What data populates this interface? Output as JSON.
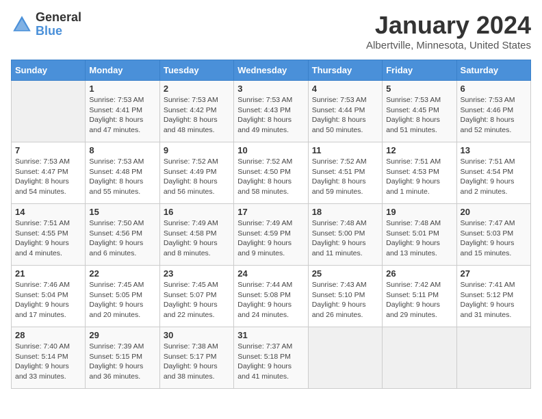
{
  "header": {
    "logo_general": "General",
    "logo_blue": "Blue",
    "month_title": "January 2024",
    "location": "Albertville, Minnesota, United States"
  },
  "days_of_week": [
    "Sunday",
    "Monday",
    "Tuesday",
    "Wednesday",
    "Thursday",
    "Friday",
    "Saturday"
  ],
  "weeks": [
    [
      {
        "day": "",
        "info": ""
      },
      {
        "day": "1",
        "info": "Sunrise: 7:53 AM\nSunset: 4:41 PM\nDaylight: 8 hours\nand 47 minutes."
      },
      {
        "day": "2",
        "info": "Sunrise: 7:53 AM\nSunset: 4:42 PM\nDaylight: 8 hours\nand 48 minutes."
      },
      {
        "day": "3",
        "info": "Sunrise: 7:53 AM\nSunset: 4:43 PM\nDaylight: 8 hours\nand 49 minutes."
      },
      {
        "day": "4",
        "info": "Sunrise: 7:53 AM\nSunset: 4:44 PM\nDaylight: 8 hours\nand 50 minutes."
      },
      {
        "day": "5",
        "info": "Sunrise: 7:53 AM\nSunset: 4:45 PM\nDaylight: 8 hours\nand 51 minutes."
      },
      {
        "day": "6",
        "info": "Sunrise: 7:53 AM\nSunset: 4:46 PM\nDaylight: 8 hours\nand 52 minutes."
      }
    ],
    [
      {
        "day": "7",
        "info": "Sunrise: 7:53 AM\nSunset: 4:47 PM\nDaylight: 8 hours\nand 54 minutes."
      },
      {
        "day": "8",
        "info": "Sunrise: 7:53 AM\nSunset: 4:48 PM\nDaylight: 8 hours\nand 55 minutes."
      },
      {
        "day": "9",
        "info": "Sunrise: 7:52 AM\nSunset: 4:49 PM\nDaylight: 8 hours\nand 56 minutes."
      },
      {
        "day": "10",
        "info": "Sunrise: 7:52 AM\nSunset: 4:50 PM\nDaylight: 8 hours\nand 58 minutes."
      },
      {
        "day": "11",
        "info": "Sunrise: 7:52 AM\nSunset: 4:51 PM\nDaylight: 8 hours\nand 59 minutes."
      },
      {
        "day": "12",
        "info": "Sunrise: 7:51 AM\nSunset: 4:53 PM\nDaylight: 9 hours\nand 1 minute."
      },
      {
        "day": "13",
        "info": "Sunrise: 7:51 AM\nSunset: 4:54 PM\nDaylight: 9 hours\nand 2 minutes."
      }
    ],
    [
      {
        "day": "14",
        "info": "Sunrise: 7:51 AM\nSunset: 4:55 PM\nDaylight: 9 hours\nand 4 minutes."
      },
      {
        "day": "15",
        "info": "Sunrise: 7:50 AM\nSunset: 4:56 PM\nDaylight: 9 hours\nand 6 minutes."
      },
      {
        "day": "16",
        "info": "Sunrise: 7:49 AM\nSunset: 4:58 PM\nDaylight: 9 hours\nand 8 minutes."
      },
      {
        "day": "17",
        "info": "Sunrise: 7:49 AM\nSunset: 4:59 PM\nDaylight: 9 hours\nand 9 minutes."
      },
      {
        "day": "18",
        "info": "Sunrise: 7:48 AM\nSunset: 5:00 PM\nDaylight: 9 hours\nand 11 minutes."
      },
      {
        "day": "19",
        "info": "Sunrise: 7:48 AM\nSunset: 5:01 PM\nDaylight: 9 hours\nand 13 minutes."
      },
      {
        "day": "20",
        "info": "Sunrise: 7:47 AM\nSunset: 5:03 PM\nDaylight: 9 hours\nand 15 minutes."
      }
    ],
    [
      {
        "day": "21",
        "info": "Sunrise: 7:46 AM\nSunset: 5:04 PM\nDaylight: 9 hours\nand 17 minutes."
      },
      {
        "day": "22",
        "info": "Sunrise: 7:45 AM\nSunset: 5:05 PM\nDaylight: 9 hours\nand 20 minutes."
      },
      {
        "day": "23",
        "info": "Sunrise: 7:45 AM\nSunset: 5:07 PM\nDaylight: 9 hours\nand 22 minutes."
      },
      {
        "day": "24",
        "info": "Sunrise: 7:44 AM\nSunset: 5:08 PM\nDaylight: 9 hours\nand 24 minutes."
      },
      {
        "day": "25",
        "info": "Sunrise: 7:43 AM\nSunset: 5:10 PM\nDaylight: 9 hours\nand 26 minutes."
      },
      {
        "day": "26",
        "info": "Sunrise: 7:42 AM\nSunset: 5:11 PM\nDaylight: 9 hours\nand 29 minutes."
      },
      {
        "day": "27",
        "info": "Sunrise: 7:41 AM\nSunset: 5:12 PM\nDaylight: 9 hours\nand 31 minutes."
      }
    ],
    [
      {
        "day": "28",
        "info": "Sunrise: 7:40 AM\nSunset: 5:14 PM\nDaylight: 9 hours\nand 33 minutes."
      },
      {
        "day": "29",
        "info": "Sunrise: 7:39 AM\nSunset: 5:15 PM\nDaylight: 9 hours\nand 36 minutes."
      },
      {
        "day": "30",
        "info": "Sunrise: 7:38 AM\nSunset: 5:17 PM\nDaylight: 9 hours\nand 38 minutes."
      },
      {
        "day": "31",
        "info": "Sunrise: 7:37 AM\nSunset: 5:18 PM\nDaylight: 9 hours\nand 41 minutes."
      },
      {
        "day": "",
        "info": ""
      },
      {
        "day": "",
        "info": ""
      },
      {
        "day": "",
        "info": ""
      }
    ]
  ]
}
